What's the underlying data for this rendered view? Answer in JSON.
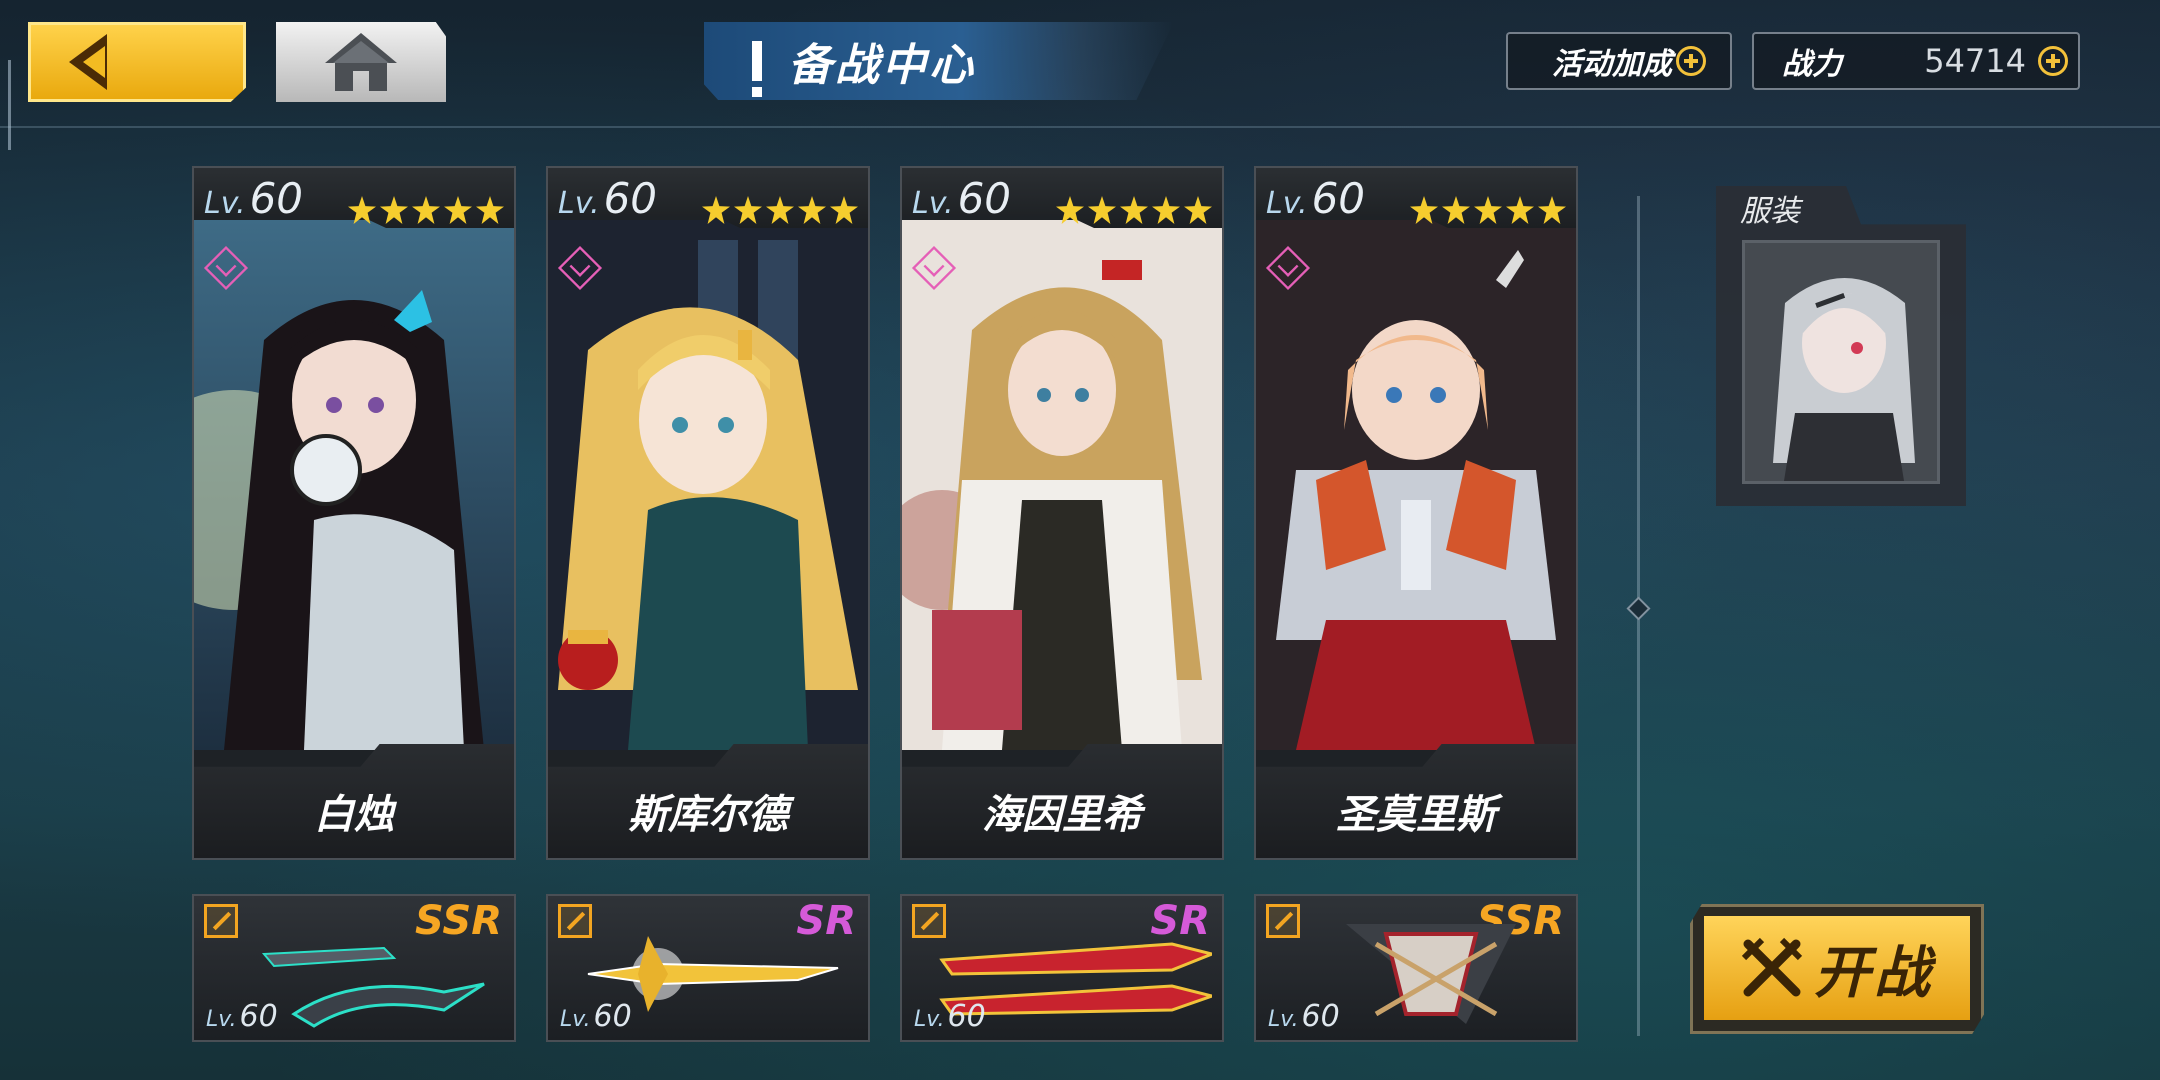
{
  "header": {
    "title": "备战中心",
    "bonus_label": "活动加成",
    "power_label": "战力",
    "power_value": "54714"
  },
  "team": [
    {
      "level_prefix": "Lv.",
      "level": "60",
      "stars": 5,
      "name": "白烛",
      "weapon": {
        "rarity": "SSR",
        "level_prefix": "Lv.",
        "level": "60"
      }
    },
    {
      "level_prefix": "Lv.",
      "level": "60",
      "stars": 5,
      "name": "斯库尔德",
      "weapon": {
        "rarity": "SR",
        "level_prefix": "Lv.",
        "level": "60"
      }
    },
    {
      "level_prefix": "Lv.",
      "level": "60",
      "stars": 5,
      "name": "海因里希",
      "weapon": {
        "rarity": "SR",
        "level_prefix": "Lv.",
        "level": "60"
      }
    },
    {
      "level_prefix": "Lv.",
      "level": "60",
      "stars": 5,
      "name": "圣莫里斯",
      "weapon": {
        "rarity": "SSR",
        "level_prefix": "Lv.",
        "level": "60"
      }
    }
  ],
  "costume": {
    "label": "服装"
  },
  "start_button": {
    "label": "开战"
  },
  "colors": {
    "accent_gold": "#f3c13a",
    "ssr": "#f6a623",
    "sr": "#d55ad8",
    "rank_pink": "#e55fb7"
  }
}
